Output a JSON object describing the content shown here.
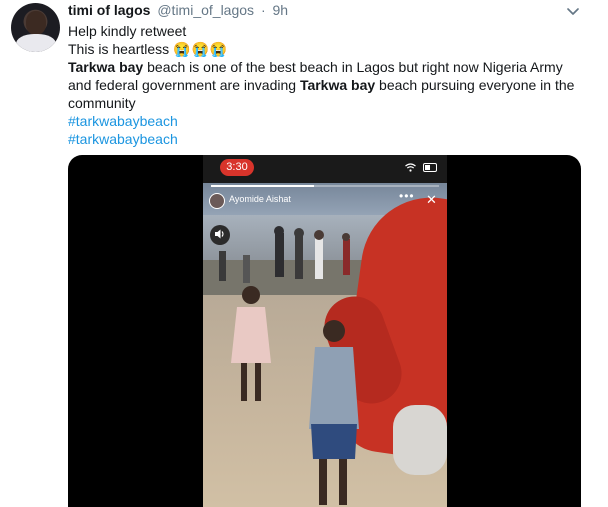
{
  "tweet": {
    "display_name": "timi of lagos",
    "handle": "@timi_of_lagos",
    "separator": "·",
    "time": "9h",
    "lines": {
      "l1": "Help kindly retweet",
      "l2": "This is heartless",
      "l2_emoji": "😭😭😭",
      "l3_bold": "Tarkwa bay",
      "l3_rest": " beach is one of the best beach in Lagos but right now Nigeria Army",
      "l4_pre": "and federal government are invading ",
      "l4_bold": "Tarkwa bay",
      "l4_post": " beach pursuing everyone in the",
      "l5": "community"
    },
    "hashtags": [
      "#tarkwabaybeach",
      "#tarkwabaybeach"
    ]
  },
  "video": {
    "clock": "3:30",
    "story_user": "Ayomide Aishat",
    "progress": 0.45
  },
  "colors": {
    "link": "#1b95e0",
    "muted": "#657786",
    "clock_badge": "#d8342b"
  },
  "icons": {
    "caret": "chevron-down-icon",
    "sound": "speaker-icon",
    "close": "close-icon",
    "more": "more-icon"
  }
}
